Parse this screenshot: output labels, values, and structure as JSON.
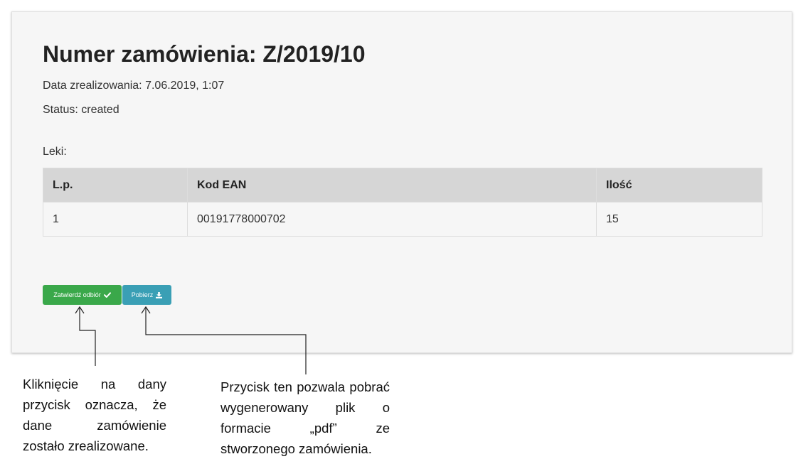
{
  "order": {
    "title": "Numer zamówienia: Z/2019/10",
    "date_line": "Data zrealizowania: 7.06.2019, 1:07",
    "status_line": "Status: created",
    "drugs_label": "Leki:"
  },
  "table": {
    "headers": [
      "L.p.",
      "Kod EAN",
      "Ilość"
    ],
    "rows": [
      [
        "1",
        "00191778000702",
        "15"
      ]
    ]
  },
  "buttons": {
    "confirm_label": "Zatwierdź odbiór",
    "confirm_icon": "check-icon",
    "download_label": "Pobierz",
    "download_icon": "download-icon"
  },
  "annotations": {
    "left_note": "Kliknięcie na dany przycisk oznacza, że dane zamówienie zostało zrealizowane.",
    "right_note": "Przycisk ten pozwala pobrać wygenerowany plik o formacie „pdf” ze stworzonego zamówienia."
  },
  "colors": {
    "confirm_button": "#3aa84a",
    "download_button": "#3a9fb5",
    "table_header": "#d6d6d6",
    "card_background": "#f6f6f6"
  }
}
